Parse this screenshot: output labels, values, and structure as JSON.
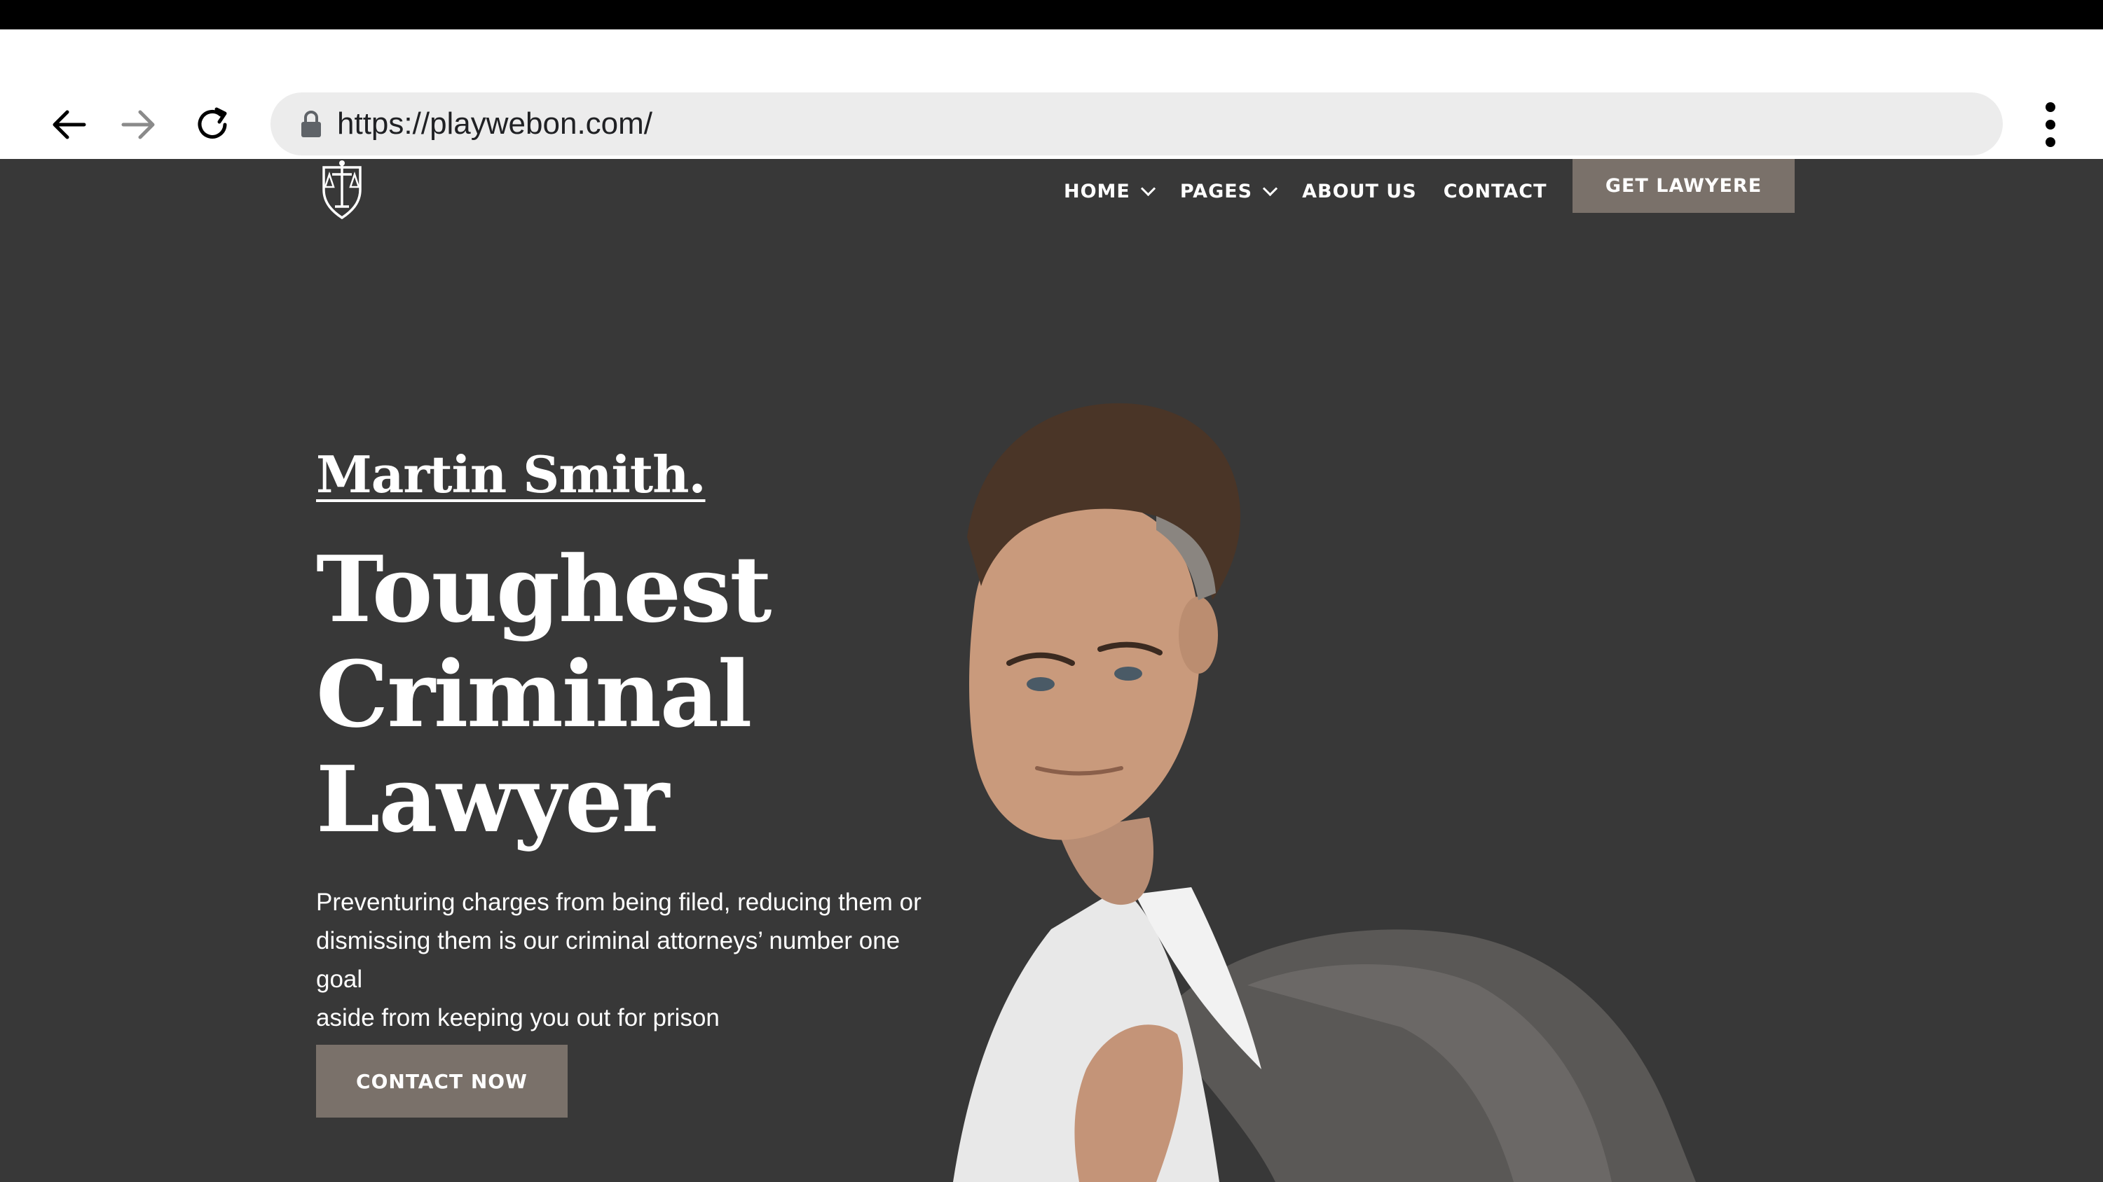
{
  "browser": {
    "url": "https://playwebon.com/",
    "back_icon": "arrow-left-icon",
    "forward_icon": "arrow-right-icon",
    "reload_icon": "reload-icon",
    "lock_icon": "lock-icon",
    "menu_icon": "kebab-menu-icon"
  },
  "site": {
    "logo_icon": "scales-shield-logo-icon",
    "nav": {
      "home": "HOME",
      "pages": "PAGES",
      "about": "ABOUT US",
      "contact": "CONTACT"
    },
    "header_cta": "GET LAWYERE"
  },
  "hero": {
    "name": "Martin Smith.",
    "headline_lines": [
      "Toughest",
      "Criminal",
      "Lawyer"
    ],
    "description_lines": [
      "Preventuring charges from being filed, reducing them or",
      "dismissing them is our criminal attorneys’ number one goal",
      "aside from keeping you out for prison"
    ],
    "cta": "CONTACT NOW"
  },
  "colors": {
    "page_bg": "#383838",
    "button_bg": "#7a716a",
    "text": "#ffffff"
  }
}
